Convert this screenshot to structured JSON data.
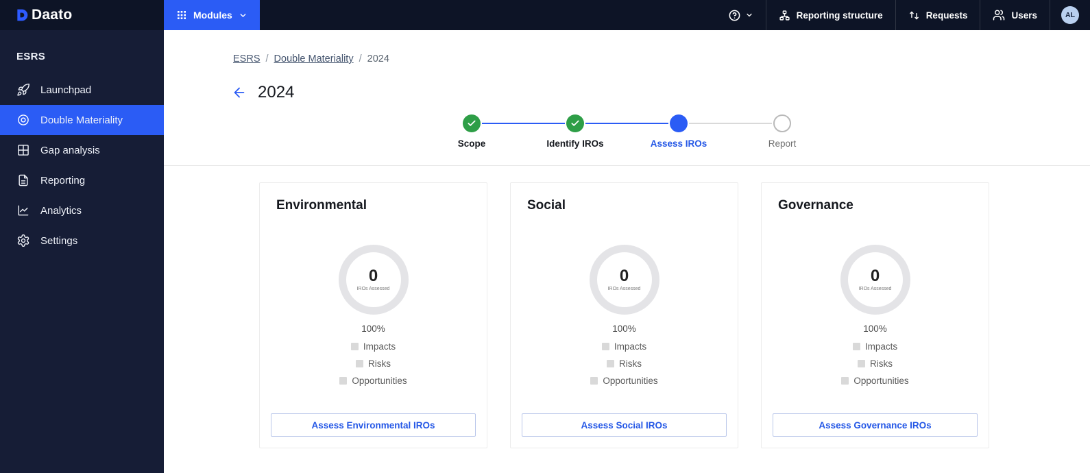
{
  "colors": {
    "accent_blue": "#2b5cf5",
    "topbar_navy": "#0d1426",
    "sidebar_navy": "#161d36",
    "success_green": "#2e9e47",
    "ring_gray": "#e4e4e7"
  },
  "brand": {
    "logo_text": "Daato"
  },
  "topbar": {
    "modules_button": "Modules",
    "reporting_structure": "Reporting structure",
    "requests": "Requests",
    "users": "Users",
    "avatar_initials": "AL"
  },
  "sidebar": {
    "section_title": "ESRS",
    "items": [
      {
        "label": "Launchpad"
      },
      {
        "label": "Double Materiality"
      },
      {
        "label": "Gap analysis"
      },
      {
        "label": "Reporting"
      },
      {
        "label": "Analytics"
      },
      {
        "label": "Settings"
      }
    ]
  },
  "breadcrumb": {
    "separator": "/",
    "items": [
      {
        "label": "ESRS"
      },
      {
        "label": "Double Materiality"
      },
      {
        "label": "2024"
      }
    ]
  },
  "page": {
    "title": "2024"
  },
  "stepper": {
    "steps": [
      {
        "label": "Scope",
        "state": "complete"
      },
      {
        "label": "Identify IROs",
        "state": "complete"
      },
      {
        "label": "Assess IROs",
        "state": "current"
      },
      {
        "label": "Report",
        "state": "upcoming"
      }
    ]
  },
  "cards": [
    {
      "title": "Environmental",
      "count": "0",
      "count_caption": "IROs Assessed",
      "percent": "100%",
      "legend": [
        "Impacts",
        "Risks",
        "Opportunities"
      ],
      "button_label": "Assess Environmental IROs"
    },
    {
      "title": "Social",
      "count": "0",
      "count_caption": "IROs Assessed",
      "percent": "100%",
      "legend": [
        "Impacts",
        "Risks",
        "Opportunities"
      ],
      "button_label": "Assess Social IROs"
    },
    {
      "title": "Governance",
      "count": "0",
      "count_caption": "IROs Assessed",
      "percent": "100%",
      "legend": [
        "Impacts",
        "Risks",
        "Opportunities"
      ],
      "button_label": "Assess Governance IROs"
    }
  ]
}
